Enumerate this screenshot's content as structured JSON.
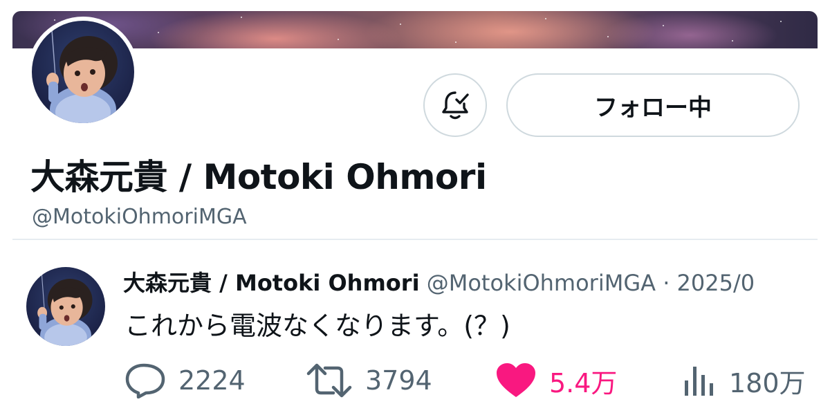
{
  "profile": {
    "display_name": "大森元貴 / Motoki Ohmori",
    "handle": "@MotokiOhmoriMGA",
    "follow_label": "フォロー中",
    "notification_icon": "bell-check-icon"
  },
  "tweet": {
    "author_name": "大森元貴 / Motoki Ohmori",
    "author_meta": "@MotokiOhmoriMGA · 2025/0",
    "text": "これから電波なくなります。(？)",
    "actions": {
      "reply_count": "2224",
      "retweet_count": "3794",
      "like_count": "5.4万",
      "view_count": "180万"
    }
  },
  "colors": {
    "text_primary": "#0f1419",
    "text_secondary": "#536471",
    "like_pink": "#f91880",
    "border": "#cfd9de"
  }
}
